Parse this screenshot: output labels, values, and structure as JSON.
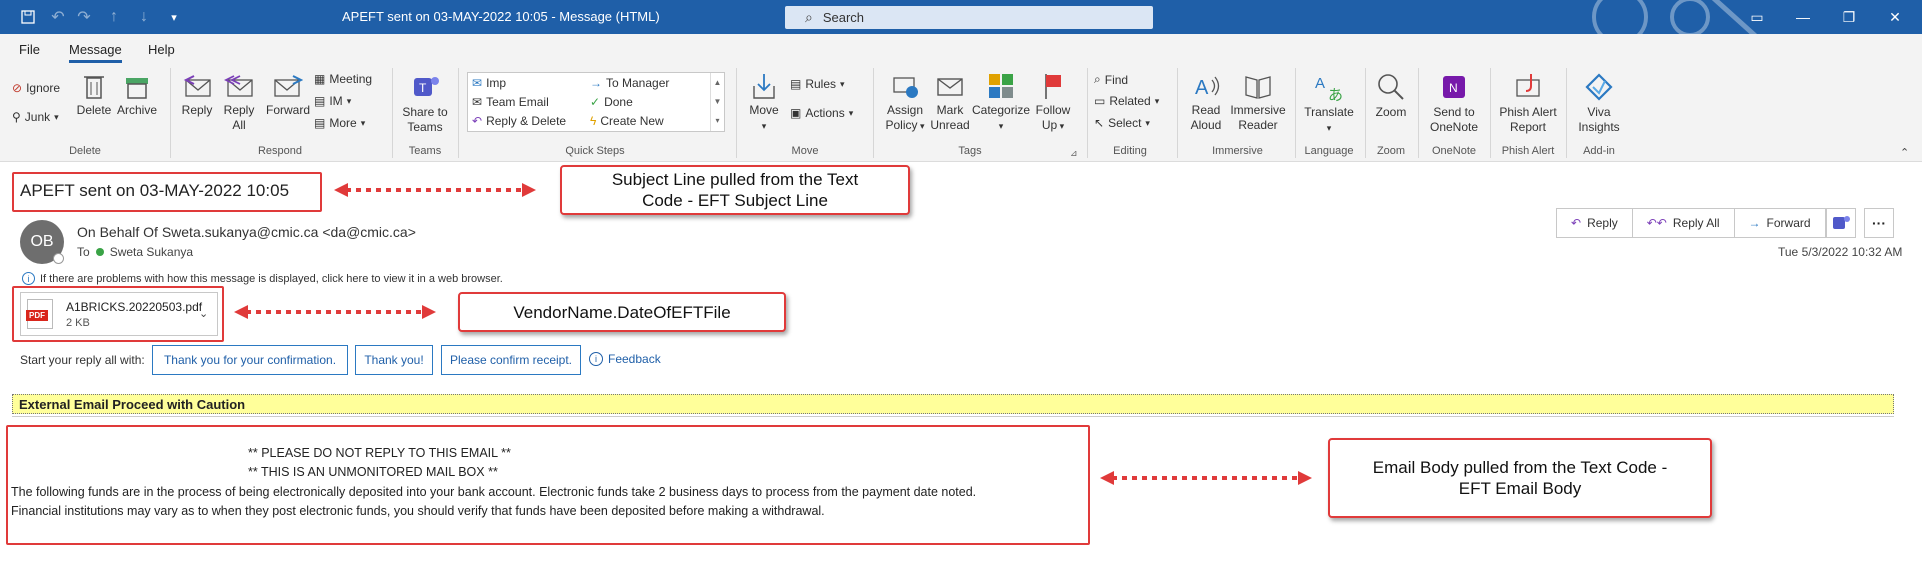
{
  "window": {
    "title": "APEFT sent on 03-MAY-2022 10:05  -  Message (HTML)",
    "search_placeholder": "Search"
  },
  "menu": {
    "file": "File",
    "message": "Message",
    "help": "Help"
  },
  "ribbon": {
    "delete_group": {
      "ignore": "Ignore",
      "junk": "Junk",
      "delete": "Delete",
      "archive": "Archive",
      "label": "Delete"
    },
    "respond_group": {
      "reply": "Reply",
      "reply_all_1": "Reply",
      "reply_all_2": "All",
      "forward": "Forward",
      "meeting": "Meeting",
      "im": "IM",
      "more": "More",
      "label": "Respond"
    },
    "teams_group": {
      "share_1": "Share to",
      "share_2": "Teams",
      "label": "Teams"
    },
    "quicksteps": {
      "imp": "Imp",
      "team_email": "Team Email",
      "reply_delete": "Reply & Delete",
      "to_manager": "To Manager",
      "done": "Done",
      "create_new": "Create New",
      "label": "Quick Steps"
    },
    "move_group": {
      "move": "Move",
      "rules": "Rules",
      "actions": "Actions",
      "label": "Move"
    },
    "tags_group": {
      "assign_1": "Assign",
      "assign_2": "Policy",
      "mark_1": "Mark",
      "mark_2": "Unread",
      "categorize": "Categorize",
      "follow_1": "Follow",
      "follow_2": "Up",
      "label": "Tags"
    },
    "editing_group": {
      "find": "Find",
      "related": "Related",
      "select": "Select",
      "label": "Editing"
    },
    "immersive_group": {
      "read_1": "Read",
      "read_2": "Aloud",
      "immersive_1": "Immersive",
      "immersive_2": "Reader",
      "label": "Immersive"
    },
    "language_group": {
      "translate": "Translate",
      "label": "Language"
    },
    "zoom_group": {
      "zoom": "Zoom",
      "label": "Zoom"
    },
    "onenote_group": {
      "send_1": "Send to",
      "send_2": "OneNote",
      "label": "OneNote"
    },
    "phish_group": {
      "phish_1": "Phish Alert",
      "phish_2": "Report",
      "label": "Phish Alert"
    },
    "addin_group": {
      "viva_1": "Viva",
      "viva_2": "Insights",
      "label": "Add-in"
    }
  },
  "message": {
    "subject": "APEFT sent on 03-MAY-2022 10:05",
    "avatar_initials": "OB",
    "from": "On Behalf Of Sweta.sukanya@cmic.ca <da@cmic.ca>",
    "to_label": "To",
    "to_name": "Sweta Sukanya",
    "info": "If there are problems with how this message is displayed, click here to view it in a web browser.",
    "date": "Tue 5/3/2022 10:32 AM",
    "actions": {
      "reply": "Reply",
      "reply_all": "Reply All",
      "forward": "Forward"
    },
    "attachment": {
      "name": "A1BRICKS.20220503.pdf",
      "size": "2 KB",
      "type": "PDF"
    },
    "suggested": {
      "label": "Start your reply all with:",
      "s1": "Thank you for your confirmation.",
      "s2": "Thank you!",
      "s3": "Please confirm receipt.",
      "feedback": "Feedback"
    },
    "warning": "External Email Proceed with Caution",
    "body": {
      "line1": "** PLEASE DO NOT REPLY TO THIS EMAIL **",
      "line2": "** THIS IS AN UNMONITORED MAIL BOX **",
      "line3": "The following funds are in the process of being electronically deposited into your bank account. Electronic funds take 2 business days to process from the payment date noted.",
      "line4": "Financial institutions may vary as to when they post electronic funds, you should verify that funds have been deposited before making a withdrawal."
    }
  },
  "annotations": {
    "subject_1": "Subject Line pulled from the Text",
    "subject_2": "Code - EFT Subject Line",
    "vendor": "VendorName.DateOfEFTFile",
    "body_1": "Email Body pulled from the Text Code -",
    "body_2": "EFT Email Body"
  },
  "colors": {
    "accent": "#1f5fa8",
    "annotation_red": "#e03a3a",
    "warning_bg": "#ffff9a"
  }
}
